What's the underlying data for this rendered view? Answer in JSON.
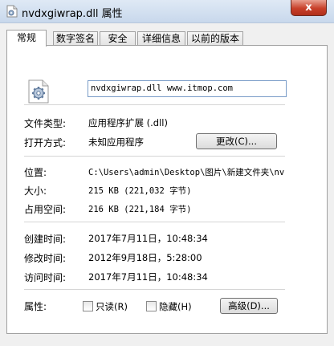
{
  "window": {
    "title": "nvdxgiwrap.dll 属性",
    "close_label": "x"
  },
  "tabs": [
    {
      "label": "常规"
    },
    {
      "label": "数字签名"
    },
    {
      "label": "安全"
    },
    {
      "label": "详细信息"
    },
    {
      "label": "以前的版本"
    }
  ],
  "general": {
    "file_name": "nvdxgiwrap.dll www.itmop.com",
    "file_type_label": "文件类型:",
    "file_type_value": "应用程序扩展 (.dll)",
    "open_with_label": "打开方式:",
    "open_with_value": "未知应用程序",
    "change_button": "更改(C)...",
    "location_label": "位置:",
    "location_value": "C:\\Users\\admin\\Desktop\\图片\\新建文件夹\\nv",
    "size_label": "大小:",
    "size_value": "215 KB (221,032 字节)",
    "disk_size_label": "占用空间:",
    "disk_size_value": "216 KB (221,184 字节)",
    "created_label": "创建时间:",
    "created_value": "2017年7月11日，10:48:34",
    "modified_label": "修改时间:",
    "modified_value": "2012年9月18日，5:28:00",
    "accessed_label": "访问时间:",
    "accessed_value": "2017年7月11日，10:48:34",
    "attributes_label": "属性:",
    "readonly_label": "只读(R)",
    "hidden_label": "隐藏(H)",
    "advanced_button": "高级(D)..."
  },
  "icons": {
    "title": "dll-file-icon",
    "file": "dll-gear-file-icon"
  }
}
